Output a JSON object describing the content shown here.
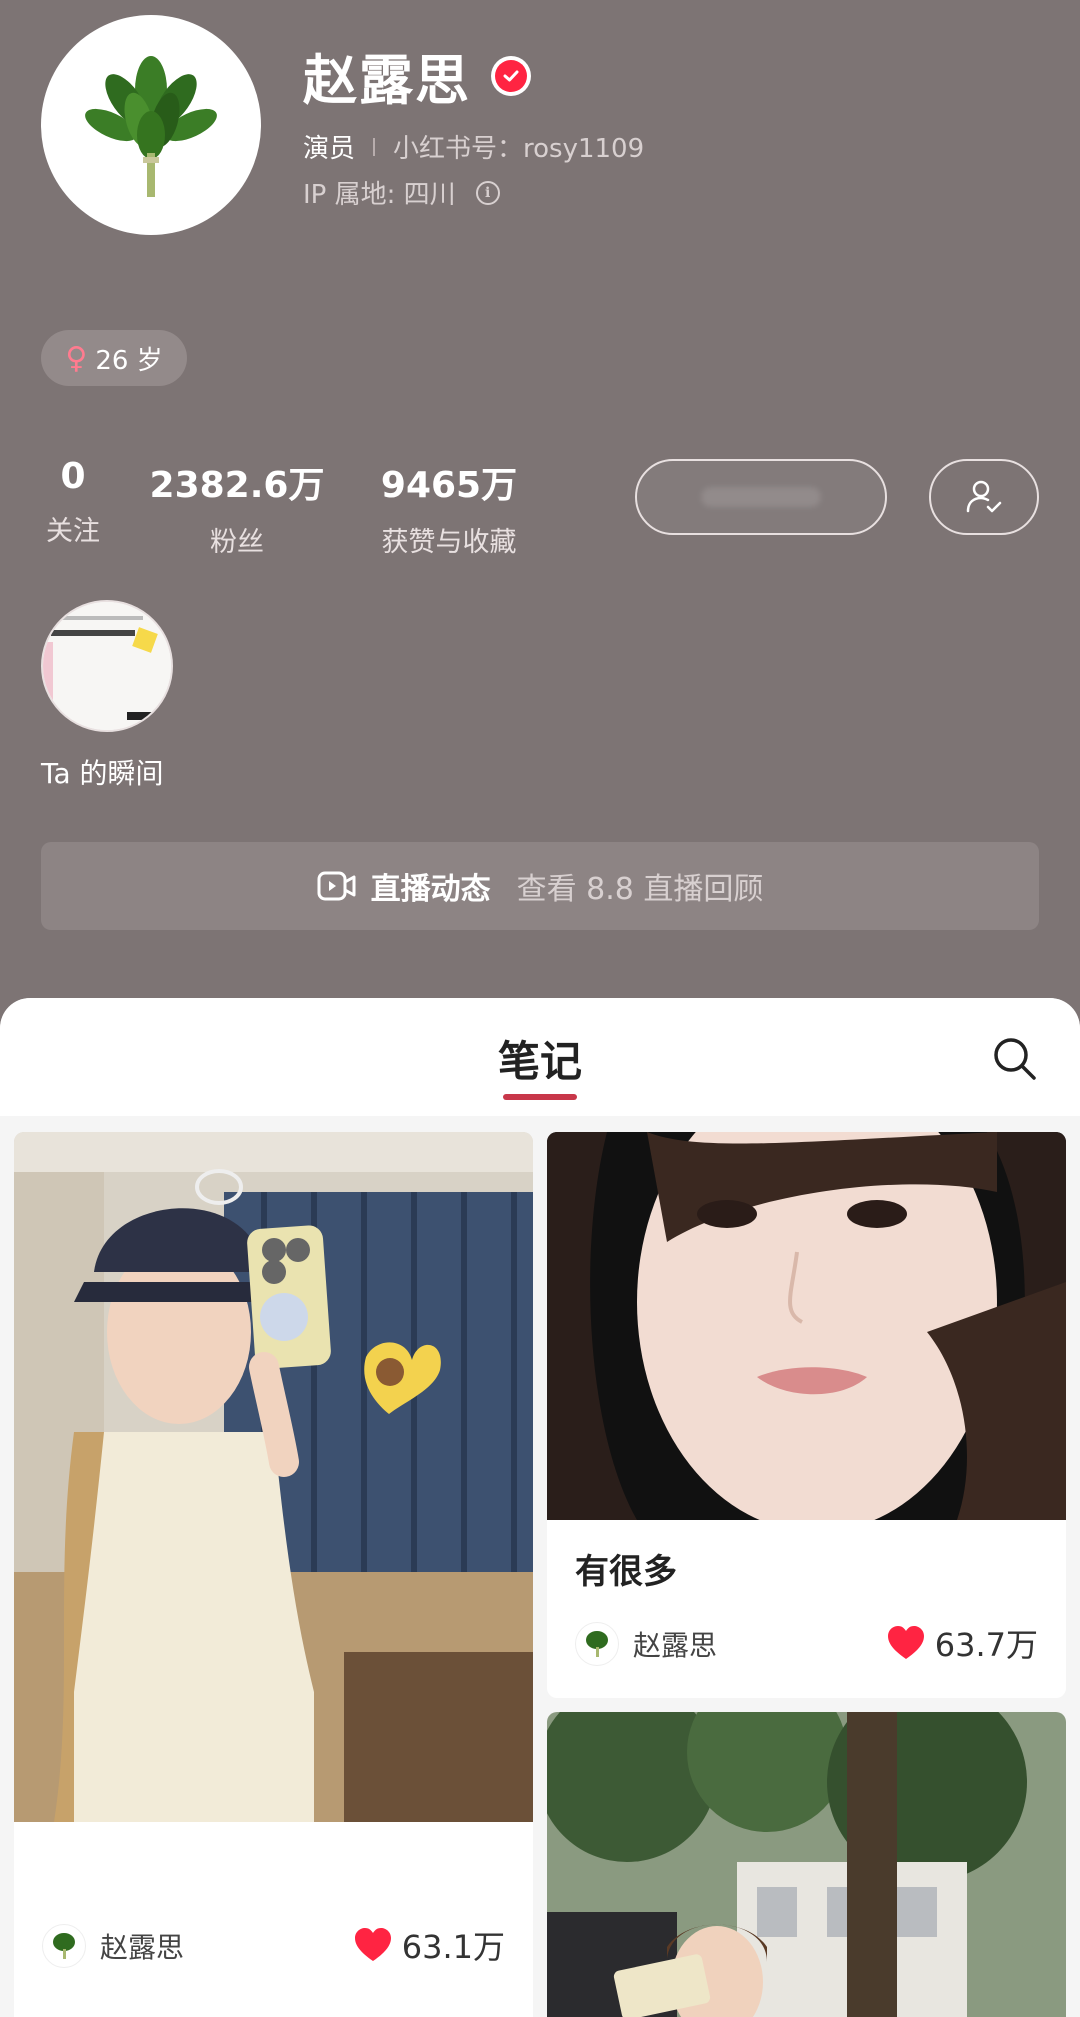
{
  "profile": {
    "name": "赵露思",
    "role": "演员",
    "red_id": "小红书号：rosy1109",
    "ip": "IP 属地: 四川",
    "age": "26 岁"
  },
  "stats": {
    "following": {
      "num": "0",
      "label": "关注"
    },
    "fans": {
      "num": "2382.6万",
      "label": "粉丝"
    },
    "likes": {
      "num": "9465万",
      "label": "获赞与收藏"
    }
  },
  "moments": {
    "label": "Ta 的瞬间"
  },
  "live": {
    "title": "直播动态",
    "subtitle": "查看 8.8 直播回顾"
  },
  "notes_tab": {
    "label": "笔记"
  },
  "notes": [
    {
      "title": "",
      "author": "赵露思",
      "likes": "63.1万",
      "emoji": "🌧"
    },
    {
      "title": "有很多",
      "author": "赵露思",
      "likes": "63.7万"
    }
  ],
  "colors": {
    "accent": "#ff2442",
    "header_bg": "#7d7474",
    "tab_underline": "#c8374a"
  }
}
